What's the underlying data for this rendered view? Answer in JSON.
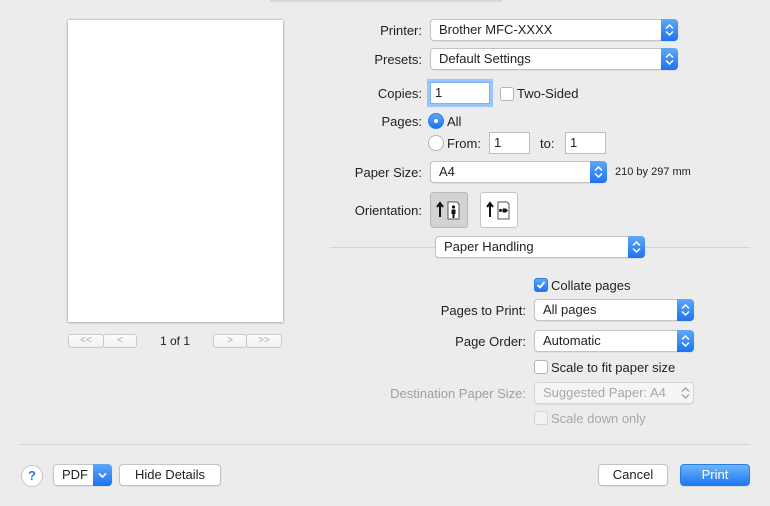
{
  "preview": {
    "page_count": "1 of 1",
    "nav": {
      "first": "<<",
      "prev": "<",
      "next": ">",
      "last": ">>"
    }
  },
  "printer": {
    "label": "Printer:",
    "value": "Brother MFC-XXXX"
  },
  "presets": {
    "label": "Presets:",
    "value": "Default Settings"
  },
  "copies": {
    "label": "Copies:",
    "value": "1",
    "two_sided_label": "Two-Sided"
  },
  "pages": {
    "label": "Pages:",
    "all_label": "All",
    "from_label": "From:",
    "from_value": "1",
    "to_label": "to:",
    "to_value": "1"
  },
  "paper_size": {
    "label": "Paper Size:",
    "value": "A4",
    "dimensions": "210 by 297 mm"
  },
  "orientation": {
    "label": "Orientation:"
  },
  "section_popup": {
    "value": "Paper Handling"
  },
  "paper_handling": {
    "collate_label": "Collate pages",
    "pages_to_print": {
      "label": "Pages to Print:",
      "value": "All pages"
    },
    "page_order": {
      "label": "Page Order:",
      "value": "Automatic"
    },
    "scale_to_fit_label": "Scale to fit paper size",
    "destination": {
      "label": "Destination Paper Size:",
      "value": "Suggested Paper: A4"
    },
    "scale_down_label": "Scale down only"
  },
  "footer": {
    "help_label": "?",
    "pdf_label": "PDF",
    "hide_details_label": "Hide Details",
    "cancel_label": "Cancel",
    "print_label": "Print"
  },
  "colors": {
    "accent": "#1c73ee",
    "background": "#ececec"
  }
}
